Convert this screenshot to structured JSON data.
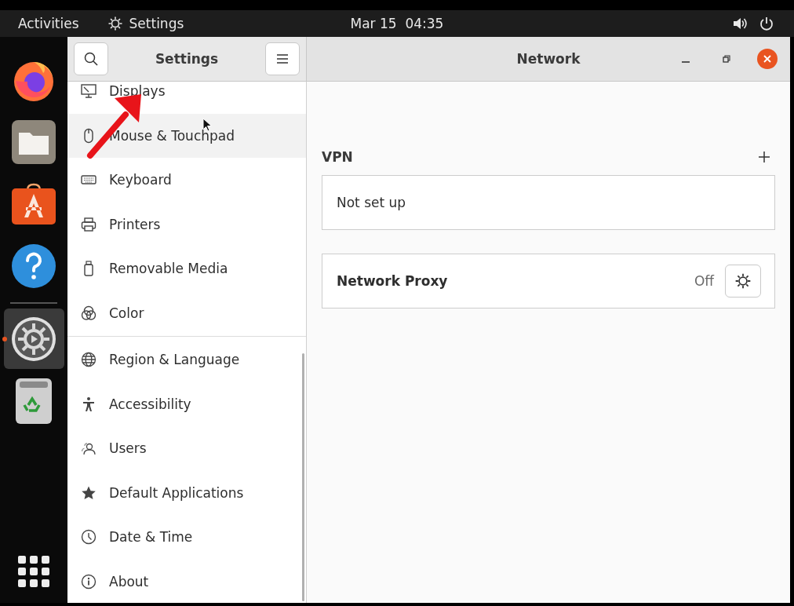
{
  "top_bar": {
    "activities": "Activities",
    "app_name": "Settings",
    "clock": "Mar 15  04:35"
  },
  "dock": {
    "items": [
      {
        "kind": "firefox",
        "running": false
      },
      {
        "kind": "files",
        "running": false
      },
      {
        "kind": "software",
        "running": false
      },
      {
        "kind": "help",
        "running": false
      },
      {
        "kind": "separator"
      },
      {
        "kind": "settings",
        "running": true
      },
      {
        "kind": "trash",
        "running": false
      }
    ]
  },
  "window": {
    "sidebar_title": "Settings",
    "title": "Network"
  },
  "sidebar": {
    "groups": [
      [
        {
          "label": "Displays",
          "hovered": false
        },
        {
          "label": "Mouse & Touchpad",
          "hovered": true
        },
        {
          "label": "Keyboard",
          "hovered": false
        },
        {
          "label": "Printers",
          "hovered": false
        },
        {
          "label": "Removable Media",
          "hovered": false
        },
        {
          "label": "Color",
          "hovered": false
        }
      ],
      [
        {
          "label": "Region & Language",
          "hovered": false
        },
        {
          "label": "Accessibility",
          "hovered": false
        },
        {
          "label": "Users",
          "hovered": false
        },
        {
          "label": "Default Applications",
          "hovered": false
        },
        {
          "label": "Date & Time",
          "hovered": false
        },
        {
          "label": "About",
          "hovered": false
        }
      ]
    ]
  },
  "content": {
    "vpn": {
      "heading": "VPN",
      "empty_text": "Not set up"
    },
    "proxy": {
      "label": "Network Proxy",
      "status": "Off"
    }
  }
}
